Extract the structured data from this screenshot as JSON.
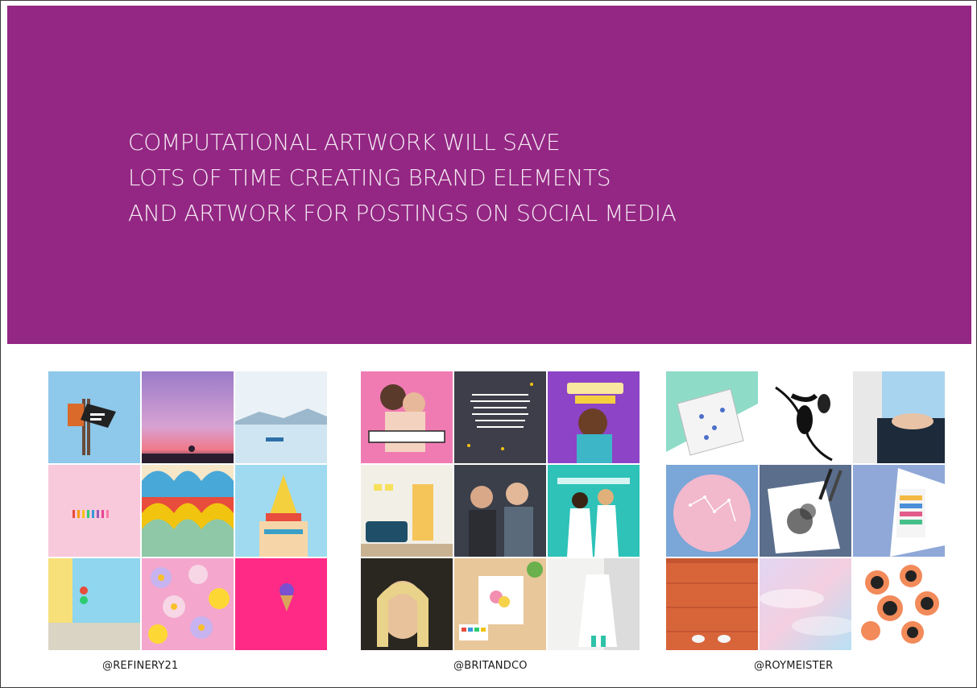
{
  "headline": {
    "lines": [
      "COMPUTATIONAL ARTWORK WILL SAVE",
      "LOTS OF TIME CREATING BRAND ELEMENTS",
      "AND ARTWORK FOR POSTINGS ON SOCIAL MEDIA"
    ]
  },
  "colors": {
    "banner": "#932783",
    "headline_text": "#f5e9f3",
    "frame_border": "#3a3a3a"
  },
  "galleries": [
    {
      "handle": "@REFINERY21",
      "tiles": [
        "blue sky with sign",
        "pink sunset sky",
        "lake with boat",
        "pink wall with candles",
        "colorful ornate shells",
        "pastel temple top",
        "blue and yellow wall",
        "pink floral pattern",
        "ice cream on pink wall"
      ]
    },
    {
      "handle": "@BRITANDCO",
      "tiles": [
        "couple illustration",
        "quote on dark background",
        "still fresh illustration",
        "room with teal sofa",
        "smiling men in crowd",
        "two women illustration",
        "blonde woman portrait",
        "watercolor painting flatlay",
        "bride in white dress"
      ]
    },
    {
      "handle": "@ROYMEISTER",
      "tiles": [
        "patterned card on mint",
        "black ink floral drawing",
        "hands with bracelet",
        "pink constellation circle",
        "ink drawing with pens",
        "colorful lettering card",
        "feet on wooden floor",
        "pastel cloud sky",
        "coral circles with drawings"
      ]
    }
  ]
}
